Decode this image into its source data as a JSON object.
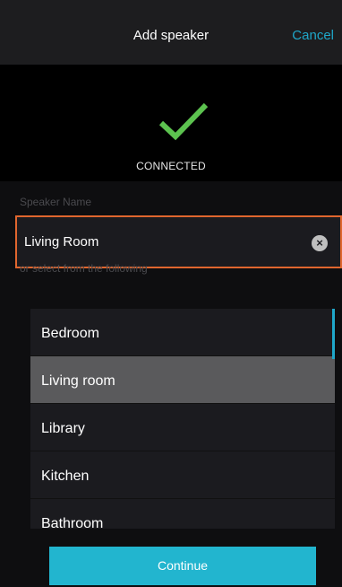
{
  "header": {
    "title": "Add speaker",
    "cancel_label": "Cancel"
  },
  "status": {
    "icon": "check-icon",
    "text": "CONNECTED"
  },
  "speaker_name": {
    "label": "Speaker Name",
    "value": "Living Room"
  },
  "selection": {
    "label": "or select from the following",
    "selected": "Living room",
    "options": [
      {
        "label": "Bedroom"
      },
      {
        "label": "Living room"
      },
      {
        "label": "Library"
      },
      {
        "label": "Kitchen"
      },
      {
        "label": "Bathroom"
      }
    ]
  },
  "footer": {
    "continue_label": "Continue"
  },
  "colors": {
    "accent": "#22b5cf",
    "focus_border": "#e0662e",
    "check": "#5cc24f",
    "selected_row": "#5a5a5c"
  }
}
